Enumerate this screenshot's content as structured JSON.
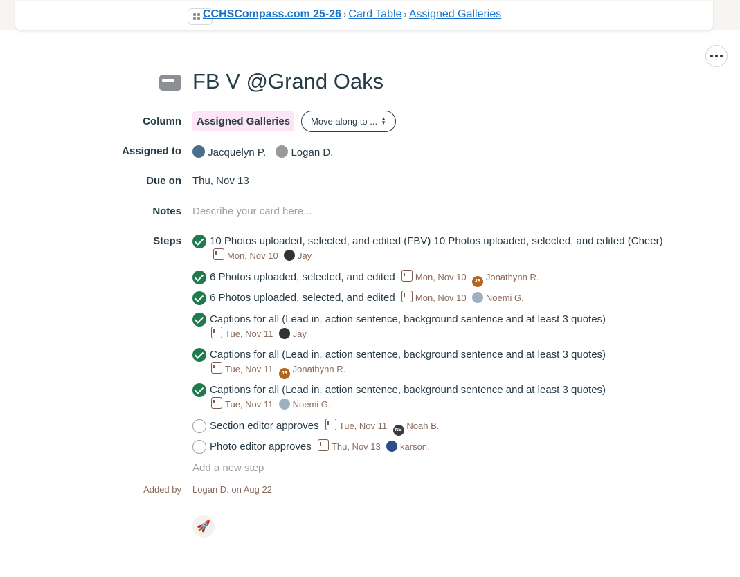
{
  "breadcrumb": {
    "project": "CCHSCompass.com 25-26",
    "tool": "Card Table",
    "column": "Assigned Galleries"
  },
  "card": {
    "title": "FB V @Grand Oaks"
  },
  "fields": {
    "column_label": "Column",
    "column_value": "Assigned Galleries",
    "move_label": "Move along to ...",
    "assigned_label": "Assigned to",
    "assignees": [
      {
        "name": "Jacquelyn P.",
        "avatar_color": "#4a6f8a"
      },
      {
        "name": "Logan D.",
        "avatar_color": "#9a9a9a"
      }
    ],
    "due_label": "Due on",
    "due_value": "Thu, Nov 13",
    "notes_label": "Notes",
    "notes_placeholder": "Describe your card here...",
    "steps_label": "Steps"
  },
  "steps": [
    {
      "done": true,
      "text": "10 Photos uploaded, selected, and edited (FBV) 10 Photos uploaded, selected, and edited (Cheer)",
      "date": "Mon, Nov 10",
      "person": "Jay",
      "avatar_initials": "",
      "avatar_color": "#333333"
    },
    {
      "done": true,
      "text": "6 Photos uploaded, selected, and edited",
      "date": "Mon, Nov 10",
      "person": "Jonathynn R.",
      "avatar_initials": "JR",
      "avatar_color": "#b5651d"
    },
    {
      "done": true,
      "text": "6 Photos uploaded, selected, and edited",
      "date": "Mon, Nov 10",
      "person": "Noemi G.",
      "avatar_initials": "",
      "avatar_color": "#9fb0bf"
    },
    {
      "done": true,
      "text": "Captions for all (Lead in, action sentence, background sentence and at least 3 quotes)",
      "date": "Tue, Nov 11",
      "person": "Jay",
      "avatar_initials": "",
      "avatar_color": "#333333"
    },
    {
      "done": true,
      "text": "Captions for all (Lead in, action sentence, background sentence and at least 3 quotes)",
      "date": "Tue, Nov 11",
      "person": "Jonathynn R.",
      "avatar_initials": "JR",
      "avatar_color": "#b5651d"
    },
    {
      "done": true,
      "text": "Captions for all (Lead in, action sentence, background sentence and at least 3 quotes)",
      "date": "Tue, Nov 11",
      "person": "Noemi G.",
      "avatar_initials": "",
      "avatar_color": "#9fb0bf"
    },
    {
      "done": false,
      "text": "Section editor approves",
      "date": "Tue, Nov 11",
      "person": "Noah B.",
      "avatar_initials": "NB",
      "avatar_color": "#3a3a3a"
    },
    {
      "done": false,
      "text": "Photo editor approves",
      "date": "Thu, Nov 13",
      "person": "karson.",
      "avatar_initials": "",
      "avatar_color": "#2c4f8a"
    }
  ],
  "add_step": "Add a new step",
  "added_by": {
    "label": "Added by",
    "value": "Logan D. on Aug 22"
  },
  "colors": {
    "link": "#1a73c9",
    "check": "#1f7a4d",
    "badge_bg": "#fce5f7",
    "meta": "#8a6a5a"
  },
  "icons": [
    "grid-icon",
    "more-icon",
    "card-icon",
    "check-icon",
    "calendar-icon",
    "boost-icon"
  ]
}
